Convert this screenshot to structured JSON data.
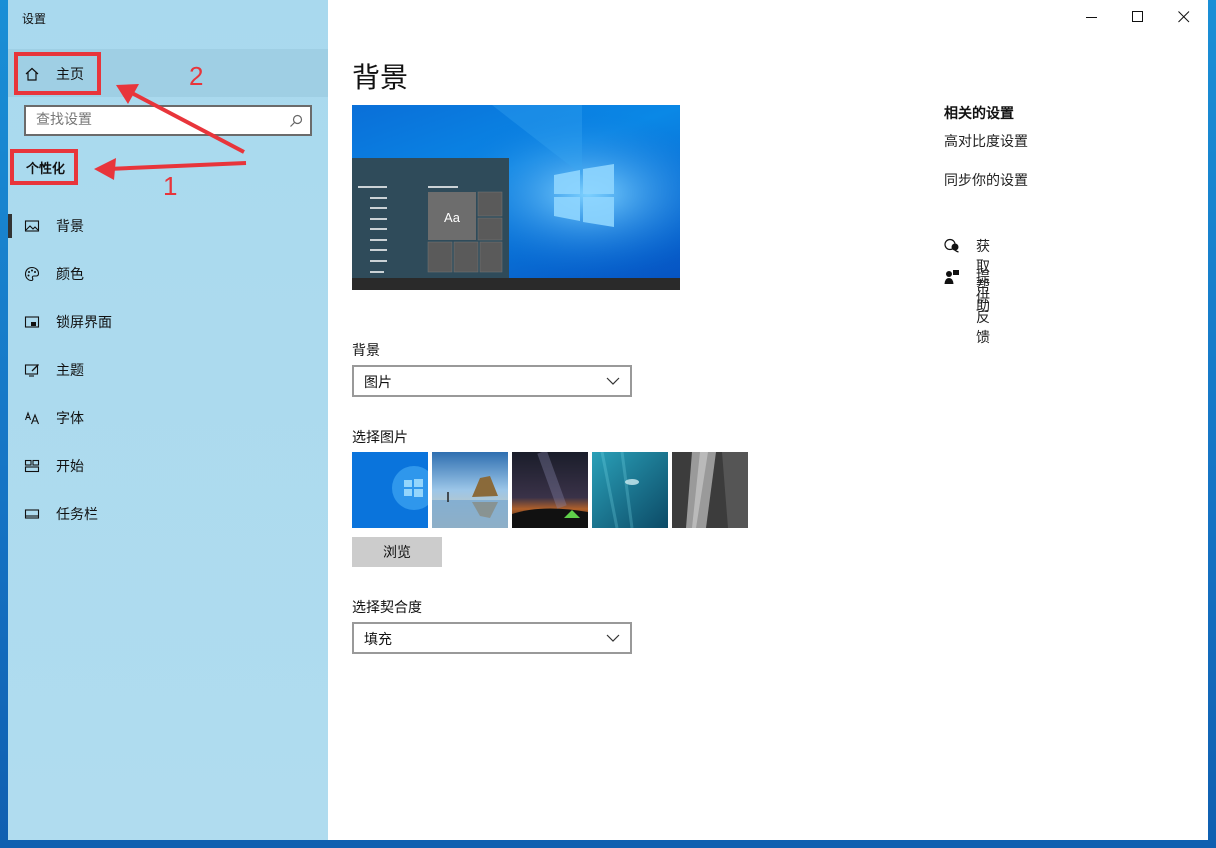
{
  "window": {
    "title": "设置"
  },
  "sidebar": {
    "home_label": "主页",
    "search_placeholder": "查找设置",
    "section_title": "个性化",
    "items": [
      {
        "label": "背景",
        "icon": "picture-icon",
        "active": true
      },
      {
        "label": "颜色",
        "icon": "palette-icon"
      },
      {
        "label": "锁屏界面",
        "icon": "lock-screen-icon"
      },
      {
        "label": "主题",
        "icon": "theme-icon"
      },
      {
        "label": "字体",
        "icon": "font-icon"
      },
      {
        "label": "开始",
        "icon": "start-icon"
      },
      {
        "label": "任务栏",
        "icon": "taskbar-icon"
      }
    ]
  },
  "annotations": {
    "label_1": "1",
    "label_2": "2",
    "color": "#e8353b"
  },
  "main": {
    "title": "背景",
    "preview": {
      "sample_text": "Aa"
    },
    "background_label": "背景",
    "background_value": "图片",
    "choose_picture_label": "选择图片",
    "browse_label": "浏览",
    "fit_label": "选择契合度",
    "fit_value": "填充"
  },
  "related": {
    "title": "相关的设置",
    "links": [
      "高对比度设置",
      "同步你的设置"
    ],
    "help": "获取帮助",
    "feedback": "提供反馈"
  },
  "colors": {
    "sidebar_bg": "#b0dcef",
    "accent": "#0078d7"
  }
}
